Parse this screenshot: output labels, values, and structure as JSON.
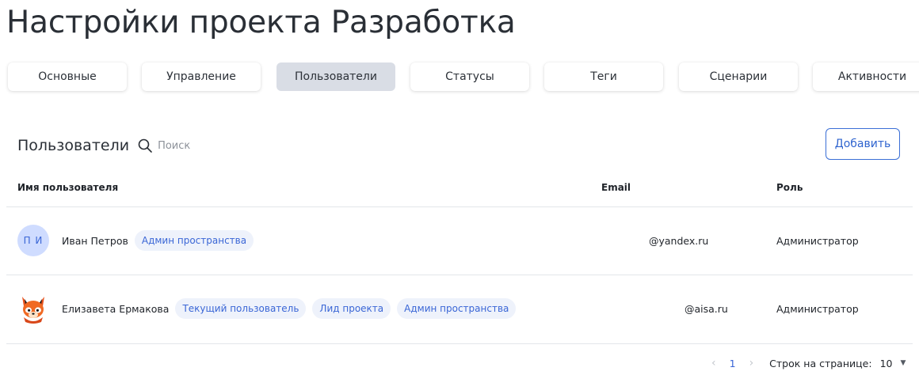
{
  "page": {
    "title": "Настройки проекта Разработка"
  },
  "tabs": [
    {
      "label": "Основные",
      "active": false
    },
    {
      "label": "Управление",
      "active": false
    },
    {
      "label": "Пользователи",
      "active": true
    },
    {
      "label": "Статусы",
      "active": false
    },
    {
      "label": "Теги",
      "active": false
    },
    {
      "label": "Сценарии",
      "active": false
    },
    {
      "label": "Активности",
      "active": false
    }
  ],
  "users_section": {
    "title": "Пользователи",
    "search_placeholder": "Поиск",
    "search_value": "",
    "add_label": "Добавить"
  },
  "table": {
    "columns": {
      "name": "Имя пользователя",
      "email": "Email",
      "role": "Роль"
    },
    "rows": [
      {
        "avatar_initials": "П И",
        "name": "Иван Петров",
        "badges": [
          "Админ пространства"
        ],
        "email": "@yandex.ru",
        "role": "Администратор"
      },
      {
        "avatar_initials": "",
        "avatar_image": "fox-avatar",
        "name": "Елизавета Ермакова",
        "badges": [
          "Текущий пользователь",
          "Лид проекта",
          "Админ пространства"
        ],
        "email": "@aisa.ru",
        "role": "Администратор"
      }
    ]
  },
  "pagination": {
    "prev": "‹",
    "current_page": "1",
    "next": "›",
    "rows_per_page_label": "Строк на странице:",
    "rows_per_page_value": "10"
  },
  "colors": {
    "accent": "#3a66d6",
    "active_tab": "#d9dde5",
    "badge_bg": "#eef2fb",
    "avatar_bg": "#cfdcff"
  }
}
